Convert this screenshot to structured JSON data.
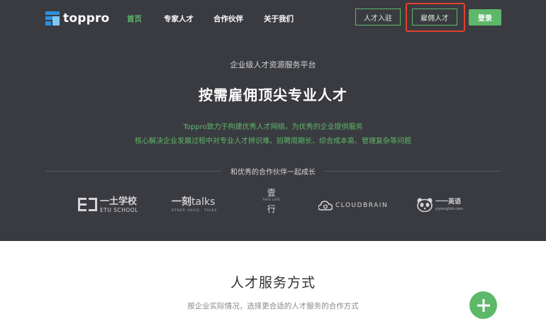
{
  "nav": {
    "logo_text": "toppro",
    "items": [
      {
        "label": "首页",
        "active": true
      },
      {
        "label": "专家人才",
        "active": false
      },
      {
        "label": "合作伙伴",
        "active": false
      },
      {
        "label": "关于我们",
        "active": false
      }
    ],
    "talent_join_label": "人才入驻",
    "hire_label": "雇佣人才",
    "login_label": "登录"
  },
  "hero": {
    "eyebrow": "企业级人才资源服务平台",
    "title": "按需雇佣顶尖专业人才",
    "desc_line1": "Toppro致力于构建优秀人才网络，为优秀的企业提供服务",
    "desc_line2": "核心解决企业发展过程中对专业人才辨识难、招聘周期长、综合成本高、管理复杂等问题",
    "partners_heading": "和优秀的合作伙伴一起成长"
  },
  "partners": {
    "etu_main": "一土学校",
    "etu_sub": "ETU SCHOOL",
    "yike_cn": "一刻",
    "yike_en": "talks",
    "yike_sub": "OTHER VOICE · TALKS",
    "tenth_a": "壹",
    "tenth_b": "行",
    "tenth_sub": "THIS LIFE",
    "cloudbrain": "CLOUDBRAIN",
    "yiyi_cn": "一一英语",
    "yiyi_sub": "yiyienglish.com"
  },
  "services": {
    "title": "人才服务方式",
    "subtitle": "按企业实际情况，选择更合适的人才服务的合作方式"
  },
  "colors": {
    "accent": "#5db869",
    "hero_bg": "#3a3b40",
    "highlight": "#e0412c"
  }
}
